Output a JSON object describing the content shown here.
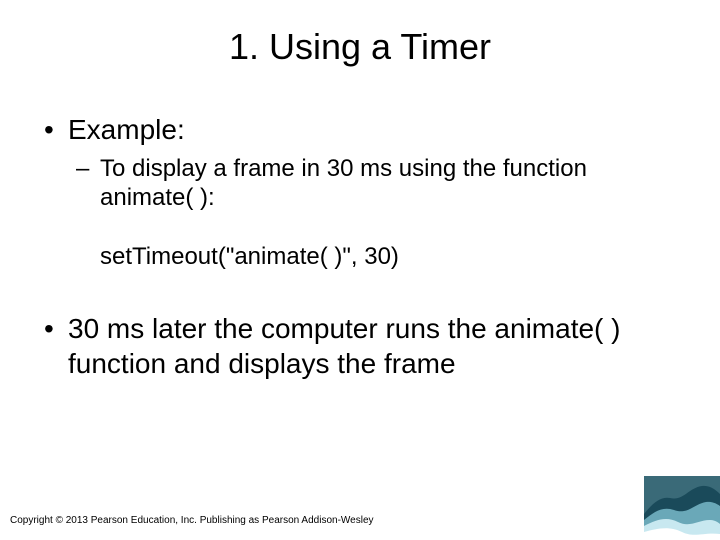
{
  "title": "1. Using a Timer",
  "bullets": {
    "example_label": "Example:",
    "sub1": "To display a frame in 30 ms using the function animate( ):",
    "code": "setTimeout(\"animate( )\", 30)",
    "result": "30 ms later the computer runs the animate( ) function and displays the frame"
  },
  "copyright": "Copyright © 2013 Pearson Education, Inc. Publishing as Pearson Addison-Wesley"
}
